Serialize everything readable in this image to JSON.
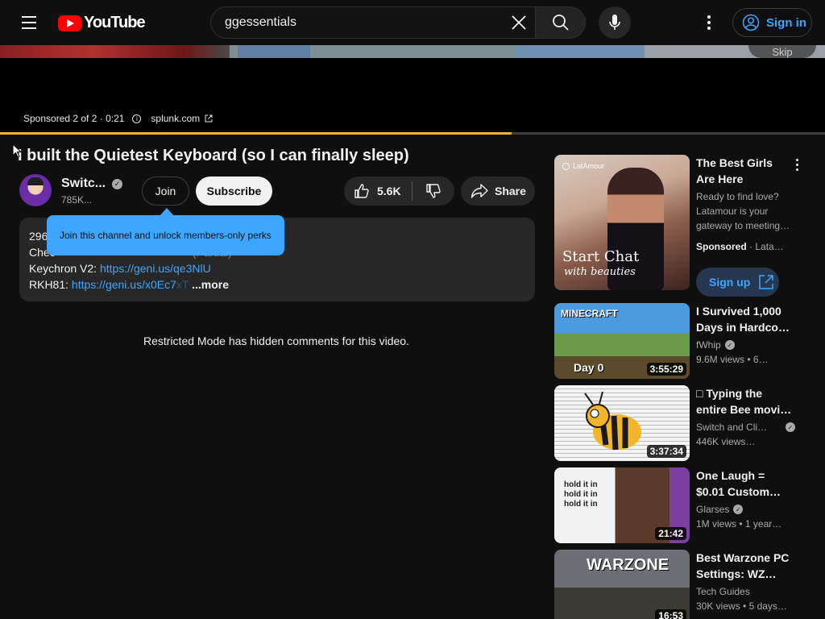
{
  "header": {
    "logo_text": "YouTube",
    "search_value": "ggessentials",
    "signin_label": "Sign in"
  },
  "player": {
    "skip_label": "Skip",
    "ad_label": "Sponsored 2 of 2 · 0:21",
    "ad_domain": "splunk.com",
    "progress": 0.62
  },
  "video": {
    "title": "I built the Quietest Keyboard (so I can finally sleep)",
    "channel_name": "Switc...",
    "subscribers": "785K...",
    "join_label": "Join",
    "subscribe_label": "Subscribe",
    "likes": "5.6K",
    "share_label": "Share"
  },
  "tooltip": {
    "text": "Join this channel and unlock members-only perks"
  },
  "description": {
    "line1_prefix": "296",
    "line2_prefix": "Chec",
    "line2_hidden": "(Partial)",
    "line3_label": "Keychron V2: ",
    "line3_link": "https://geni.us/qe3NlU",
    "line4_label": "RKH81: ",
    "line4_link": "https://geni.us/x0Ec7xT",
    "more_label": "...more"
  },
  "comments": {
    "restricted_text": "Restricted Mode has hidden comments for this video."
  },
  "sidebar_ad": {
    "brand": "LatAmour",
    "cta_line1": "Start Chat",
    "cta_line2": "with beauties",
    "title": "The Best Girls Are Here",
    "description": "Ready to find love? Latamour is your gateway to meeting…",
    "sponsored_label": "Sponsored",
    "advertiser": "Lata…",
    "signup_label": "Sign up"
  },
  "recommendations": [
    {
      "title_line1": "I Survived 1,000",
      "title_line2": "Days in Hardcor…",
      "channel": "fWhip",
      "verified": true,
      "views": "9.6M views",
      "age": "6…",
      "duration": "3:55:29",
      "thumb_text": "Day 0"
    },
    {
      "title_line1": "□ Typing the",
      "title_line2": "entire Bee movi…",
      "channel": "Switch and Cli…",
      "verified": true,
      "views": "446K views…",
      "age": "",
      "duration": "3:37:34",
      "thumb_text": ""
    },
    {
      "title_line1": "One Laugh =",
      "title_line2": "$0.01 Custom…",
      "channel": "Glarses",
      "verified": true,
      "views": "1M views",
      "age": "1 year…",
      "duration": "21:42",
      "thumb_text": "hold it in"
    },
    {
      "title_line1": "Best Warzone PC",
      "title_line2": "Settings: WZ…",
      "channel": "Tech Guides",
      "verified": false,
      "views": "30K views",
      "age": "5 days…",
      "duration": "16:53",
      "thumb_text": "WARZONE"
    }
  ]
}
